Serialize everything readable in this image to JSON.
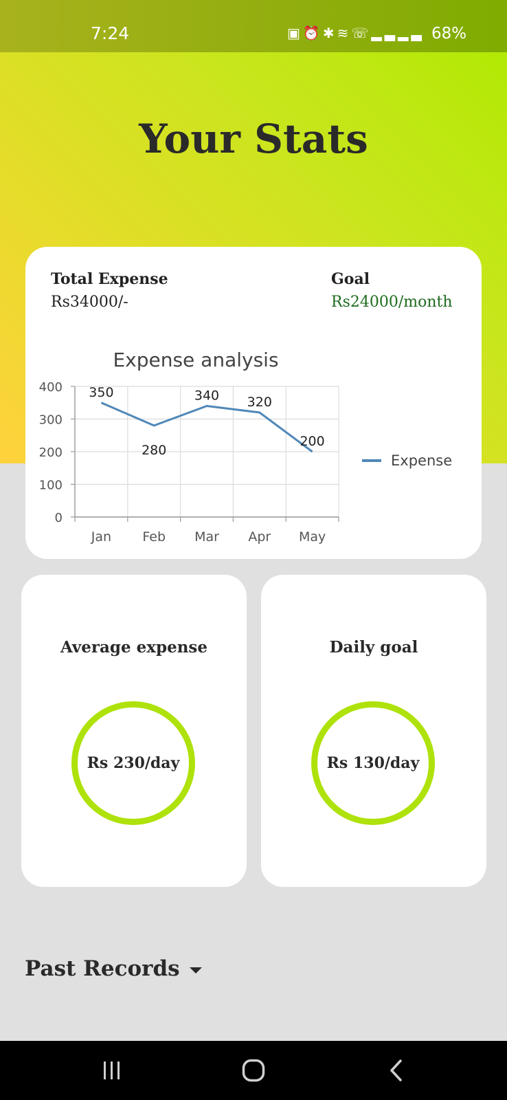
{
  "status_bar": {
    "time": "7:24",
    "icons": [
      "battery-saver-icon",
      "alarm-icon",
      "bluetooth-icon",
      "wifi-icon",
      "wifi-call-icon",
      "signal-icon",
      "signal-icon"
    ],
    "battery": "68%"
  },
  "header": {
    "title": "Your Stats"
  },
  "summary": {
    "total_expense_label": "Total Expense",
    "total_expense_value": "Rs34000/-",
    "goal_label": "Goal",
    "goal_value": "Rs24000/month",
    "goal_color": "#1e6b1e"
  },
  "chart_data": {
    "type": "line",
    "title": "Expense analysis",
    "categories": [
      "Jan",
      "Feb",
      "Mar",
      "Apr",
      "May"
    ],
    "series": [
      {
        "name": "Expense",
        "values": [
          350,
          280,
          340,
          320,
          200
        ],
        "color": "#4f87b8"
      }
    ],
    "yticks": [
      0,
      100,
      200,
      300,
      400
    ],
    "ylim": [
      0,
      400
    ],
    "grid": true,
    "legend": "right"
  },
  "cards": {
    "average": {
      "title": "Average expense",
      "value": "Rs 230/day"
    },
    "daily": {
      "title": "Daily goal",
      "value": "Rs 130/day"
    },
    "ring_color": "#aee20a"
  },
  "past_records": {
    "label": "Past Records",
    "icon": "caret-down-icon"
  },
  "nav": {
    "icons": [
      "recent-apps-icon",
      "home-icon",
      "back-icon"
    ]
  }
}
